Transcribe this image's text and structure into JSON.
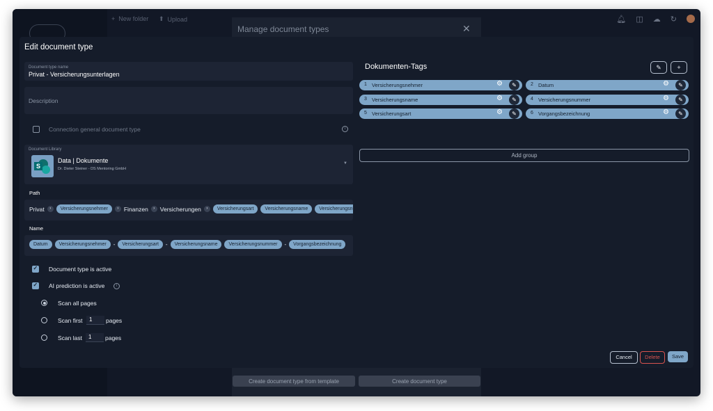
{
  "background": {
    "toolbar": {
      "new_folder": "New folder",
      "upload": "Upload"
    },
    "panel_title": "Manage document types",
    "close_symbol": "✕",
    "buttons": {
      "from_template": "Create document type from template",
      "create": "Create document type"
    }
  },
  "modal": {
    "title": "Edit document type",
    "doc_type_name": {
      "label": "Document type name",
      "value": "Privat - Versicherungsunterlagen"
    },
    "description": {
      "placeholder": "Description"
    },
    "connection": {
      "label": "Connection general document type",
      "checked": false
    },
    "library": {
      "label": "Document Library",
      "name": "Data | Dokumente",
      "owner": "Dr. Dieter Steiner - DS Mentoring GmbH",
      "icon": "sharepoint-icon",
      "icon_letter": "S"
    },
    "path": {
      "label": "Path",
      "segments": [
        {
          "type": "text",
          "value": "Privat"
        },
        {
          "type": "arrow"
        },
        {
          "type": "chip",
          "value": "Versicherungsnehmer"
        },
        {
          "type": "arrow"
        },
        {
          "type": "text",
          "value": "Finanzen"
        },
        {
          "type": "arrow"
        },
        {
          "type": "text",
          "value": "Versicherungen"
        },
        {
          "type": "arrow"
        },
        {
          "type": "chip",
          "value": "Versicherungsart"
        },
        {
          "type": "chip",
          "value": "Versicherungsname"
        },
        {
          "type": "chip",
          "value": "Versicherungsnummer"
        }
      ]
    },
    "name": {
      "label": "Name",
      "segments": [
        {
          "type": "chip",
          "value": "Datum"
        },
        {
          "type": "chip",
          "value": "Versicherungsnehmer"
        },
        {
          "type": "sep",
          "value": "-"
        },
        {
          "type": "chip",
          "value": "Versicherungsart"
        },
        {
          "type": "sep",
          "value": "-"
        },
        {
          "type": "chip",
          "value": "Versicherungsname"
        },
        {
          "type": "chip",
          "value": "Versicherungsnummer"
        },
        {
          "type": "sep",
          "value": "-"
        },
        {
          "type": "chip",
          "value": "Vorgangsbezeichnung"
        }
      ]
    },
    "active": {
      "label": "Document type is active",
      "checked": true
    },
    "ai": {
      "label": "AI prediction is active",
      "checked": true
    },
    "scan": {
      "all": {
        "label": "Scan all pages",
        "selected": true
      },
      "first": {
        "label": "Scan first",
        "value": "1",
        "suffix": "pages"
      },
      "last": {
        "label": "Scan last",
        "value": "1",
        "suffix": "pages"
      }
    },
    "tags": {
      "title": "Dokumenten-Tags",
      "items": [
        {
          "num": "1",
          "name": "Versicherungsnehmer"
        },
        {
          "num": "2",
          "name": "Datum"
        },
        {
          "num": "3",
          "name": "Versicherungsname"
        },
        {
          "num": "4",
          "name": "Versicherungsnummer"
        },
        {
          "num": "5",
          "name": "Versicherungsart"
        },
        {
          "num": "6",
          "name": "Vorgangsbezeichnung"
        }
      ],
      "add_group": "Add group"
    },
    "footer": {
      "cancel": "Cancel",
      "delete": "Delete",
      "save": "Save"
    }
  },
  "colors": {
    "accent": "#7fa6c8",
    "delete": "#d9534f",
    "modal_bg": "#151c2a",
    "field_bg": "#1d2434"
  }
}
